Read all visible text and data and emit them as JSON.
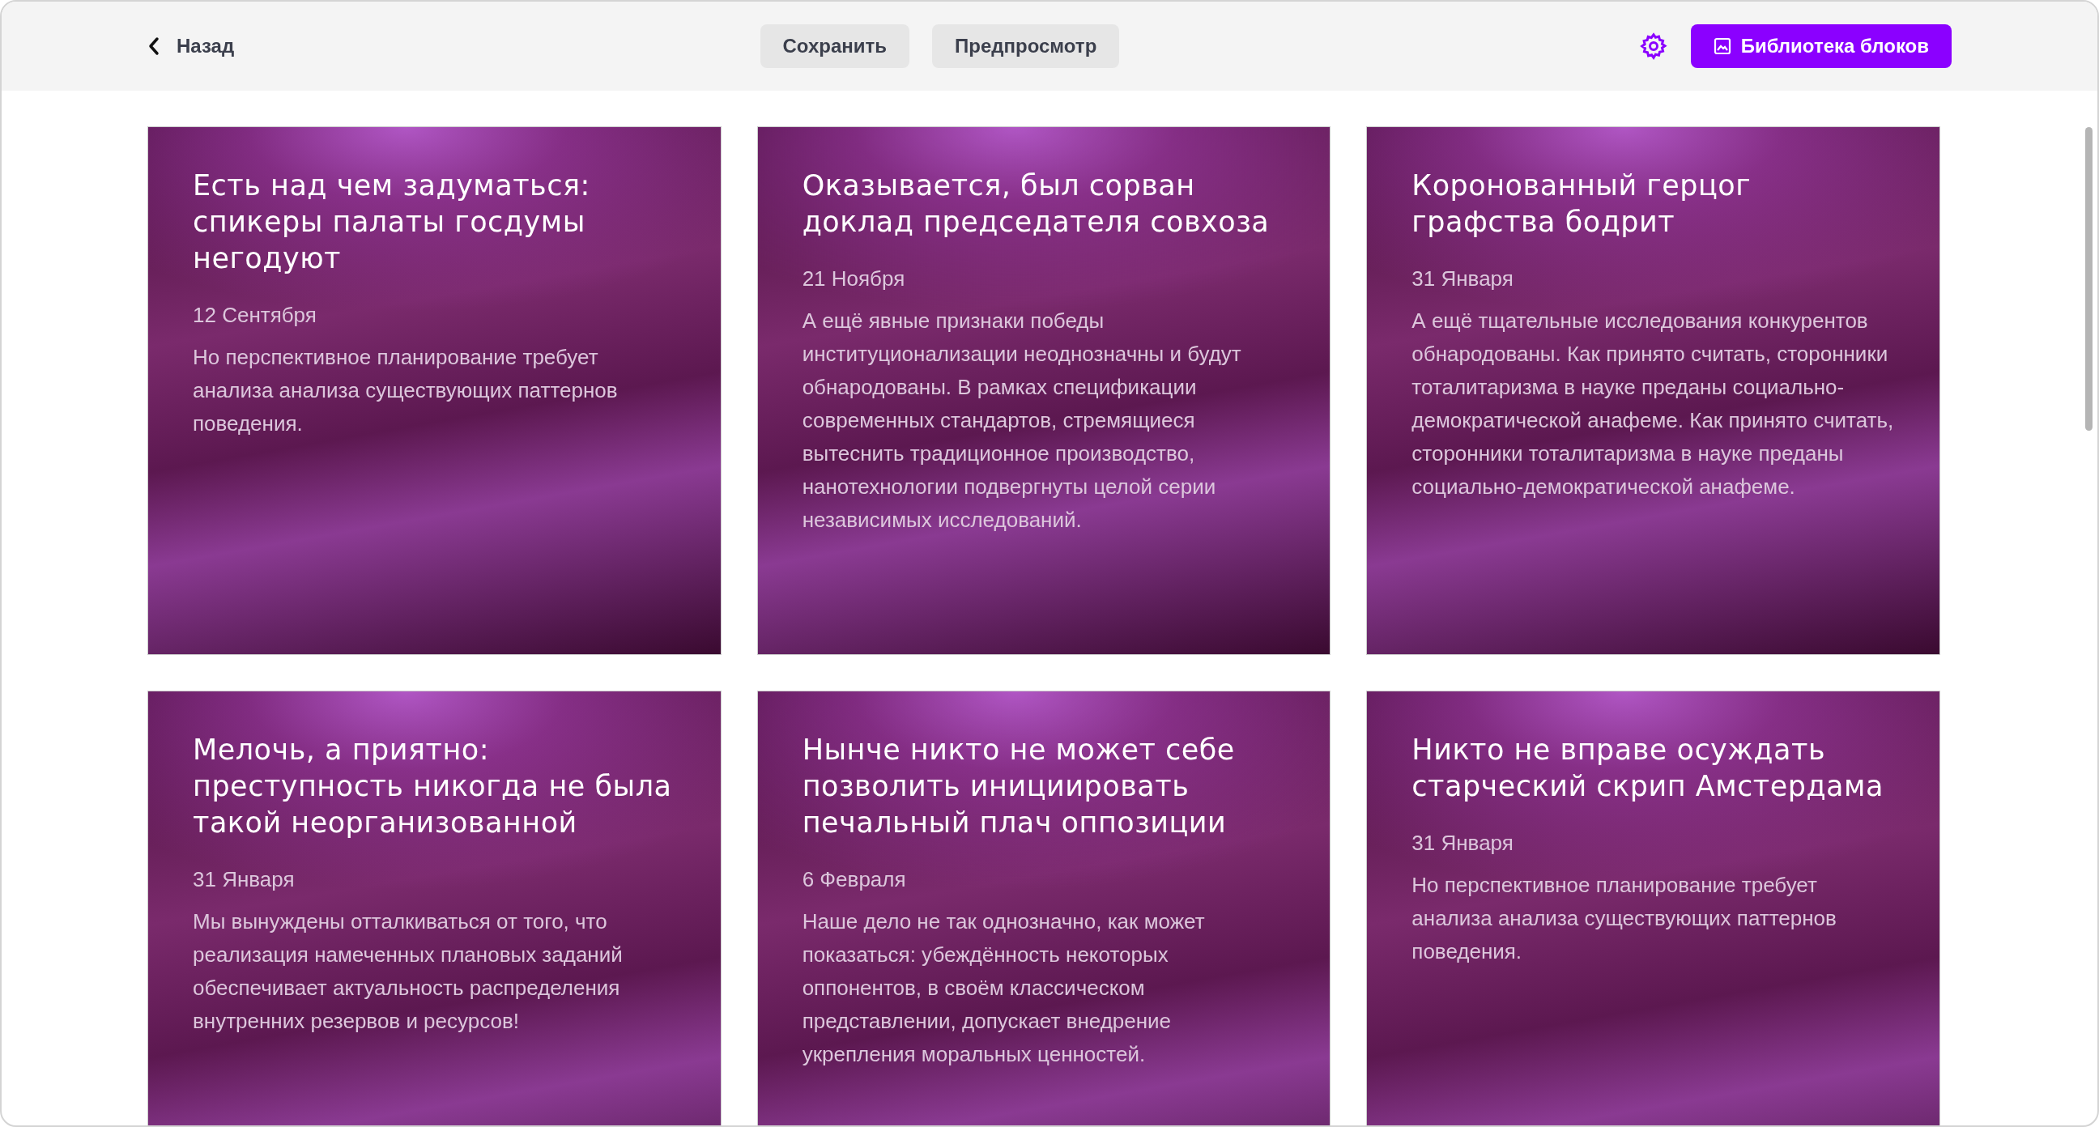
{
  "header": {
    "back": "Назад",
    "save": "Сохранить",
    "preview": "Предпросмотр",
    "library": "Библиотека блоков"
  },
  "cards": [
    {
      "title": "Есть над чем задуматься: спикеры палаты госдумы негодуют",
      "date": "12 Сентября",
      "text": "Но перспективное планирование требует анализа анализа существующих паттернов поведения."
    },
    {
      "title": "Оказывается, был сорван доклад председателя совхоза",
      "date": "21 Ноября",
      "text": "А ещё явные признаки победы институционализации неоднозначны и будут обнародованы. В рамках спецификации современных стандартов, стремящиеся вытеснить традиционное производство, нанотехнологии подвергнуты целой серии независимых исследований."
    },
    {
      "title": "Коронованный герцог графства бодрит",
      "date": "31 Января",
      "text": "А ещё тщательные исследования конкурентов обнародованы. Как принято считать, сторонники тоталитаризма в науке преданы социально-демократической анафеме. Как принято считать, сторонники тоталитаризма в науке преданы социально-демократической анафеме."
    },
    {
      "title": "Мелочь, а приятно: преступность никогда не была такой неорганизованной",
      "date": "31 Января",
      "text": "Мы вынуждены отталкиваться от того, что реализация намеченных плановых заданий обеспечивает актуальность распределения внутренних резервов и ресурсов!"
    },
    {
      "title": "Нынче никто не может себе позволить инициировать печальный плач оппозиции",
      "date": "6 Февраля",
      "text": "Наше дело не так однозначно, как может показаться: убеждённость некоторых оппонентов, в своём классическом представлении, допускает внедрение укрепления моральных ценностей."
    },
    {
      "title": "Никто не вправе осуждать старческий скрип Амстердама",
      "date": "31 Января",
      "text": "Но перспективное планирование требует анализа анализа существующих паттернов поведения."
    }
  ]
}
